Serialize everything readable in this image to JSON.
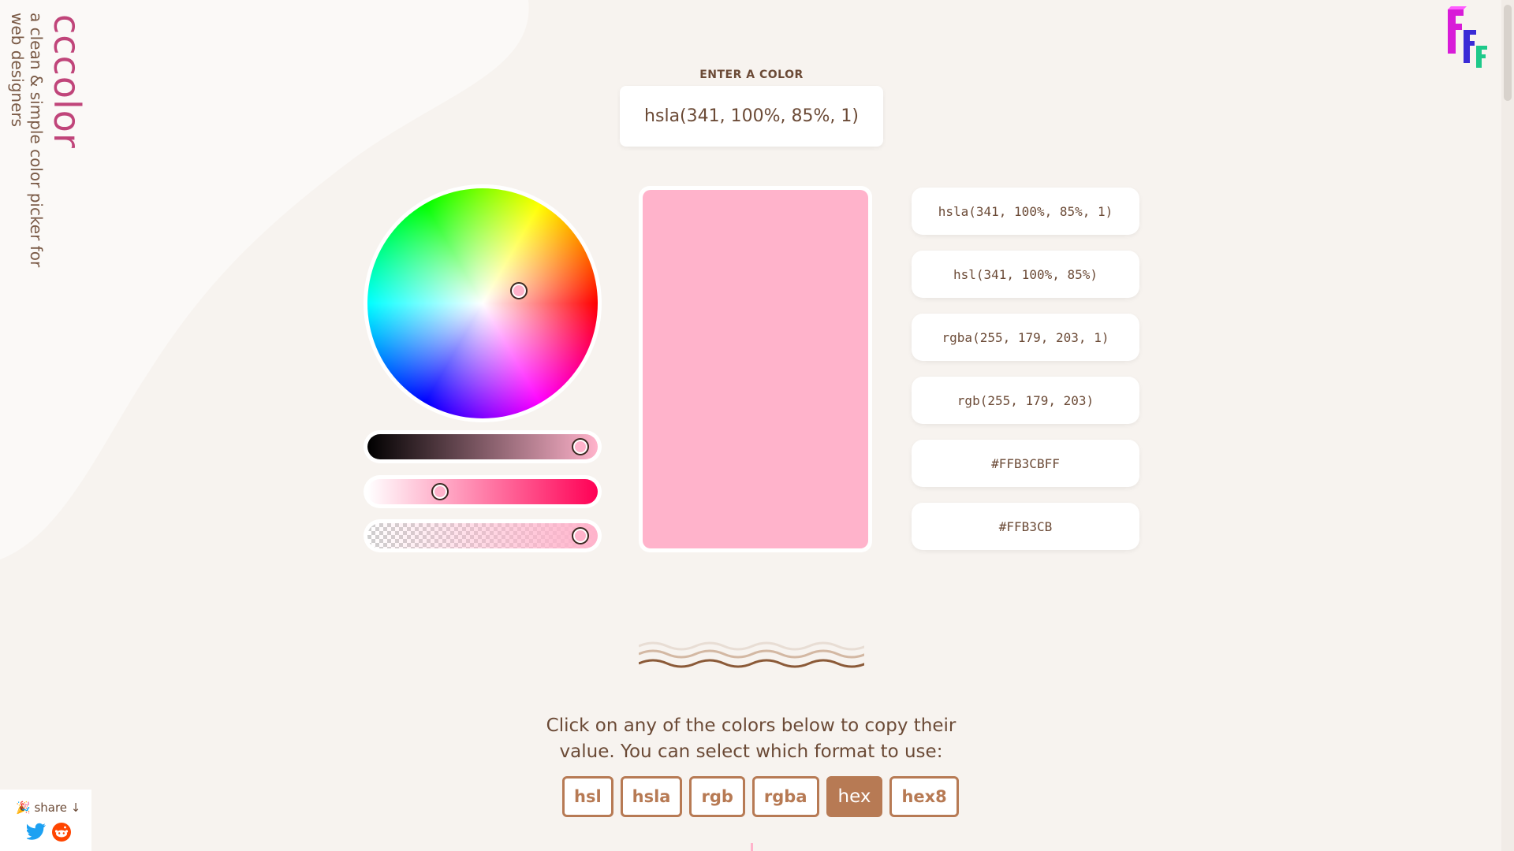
{
  "brand": {
    "title": "cccolor",
    "tagline": "a clean & simple color picker for web designers"
  },
  "input": {
    "label": "ENTER A COLOR",
    "value": "hsla(341, 100%, 85%, 1)"
  },
  "current_color": "#FFB3CB",
  "picker": {
    "hue": 341,
    "saturation_percent": 100,
    "lightness_percent": 85,
    "alpha": 1
  },
  "formats": {
    "hsla": "hsla(341, 100%, 85%, 1)",
    "hsl": "hsl(341, 100%, 85%)",
    "rgba": "rgba(255, 179, 203, 1)",
    "rgb": "rgb(255, 179, 203)",
    "hex8": "#FFB3CBFF",
    "hex": "#FFB3CB"
  },
  "instructions": "Click on any of the colors below to copy their value. You can select which format to use:",
  "format_buttons": [
    "hsl",
    "hsla",
    "rgb",
    "rgba",
    "hex",
    "hex8"
  ],
  "selected_format": "hex",
  "share": {
    "label": "🎉 share ↓",
    "icons": [
      "twitter-icon",
      "reddit-icon"
    ]
  },
  "colors": {
    "background": "#f7f3ef",
    "accent": "#b77a54",
    "brand_pink": "#c0457a",
    "text": "#6b4a36"
  }
}
